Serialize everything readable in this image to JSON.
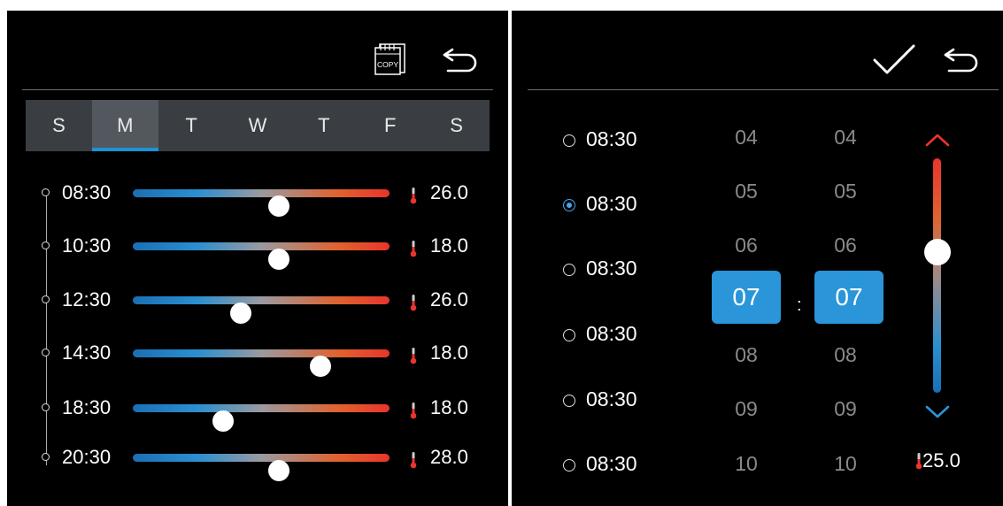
{
  "schedule_panel": {
    "copy_icon_label": "COPY",
    "days": [
      {
        "label": "S",
        "active": false
      },
      {
        "label": "M",
        "active": true
      },
      {
        "label": "T",
        "active": false
      },
      {
        "label": "W",
        "active": false
      },
      {
        "label": "T",
        "active": false
      },
      {
        "label": "F",
        "active": false
      },
      {
        "label": "S",
        "active": false
      }
    ],
    "rows": [
      {
        "time": "08:30",
        "temp": "26.0",
        "level": 0.57
      },
      {
        "time": "10:30",
        "temp": "18.0",
        "level": 0.57
      },
      {
        "time": "12:30",
        "temp": "26.0",
        "level": 0.42
      },
      {
        "time": "14:30",
        "temp": "18.0",
        "level": 0.73
      },
      {
        "time": "18:30",
        "temp": "18.0",
        "level": 0.35
      },
      {
        "time": "20:30",
        "temp": "28.0",
        "level": 0.57
      }
    ],
    "colors": {
      "active_underline": "#1e90d6",
      "track_cold": "#1b6fb3",
      "track_hot": "#e8352d"
    }
  },
  "edit_panel": {
    "slots": [
      {
        "time": "08:30",
        "selected": false
      },
      {
        "time": "08:30",
        "selected": true
      },
      {
        "time": "08:30",
        "selected": false
      },
      {
        "time": "08:30",
        "selected": false
      },
      {
        "time": "08:30",
        "selected": false
      },
      {
        "time": "08:30",
        "selected": false
      }
    ],
    "hour_above": [
      "04",
      "05",
      "06"
    ],
    "hour_selected": "07",
    "hour_below": [
      "08",
      "09",
      "10"
    ],
    "minute_above": [
      "04",
      "05",
      "06"
    ],
    "minute_selected": "07",
    "minute_below": [
      "08",
      "09",
      "10"
    ],
    "separator": ":",
    "set_temp": "25.0",
    "temp_level": 0.6,
    "colors": {
      "picker_highlight": "#2a95d8",
      "arrow_up": "#e8352d",
      "arrow_down": "#2a95d8"
    }
  }
}
